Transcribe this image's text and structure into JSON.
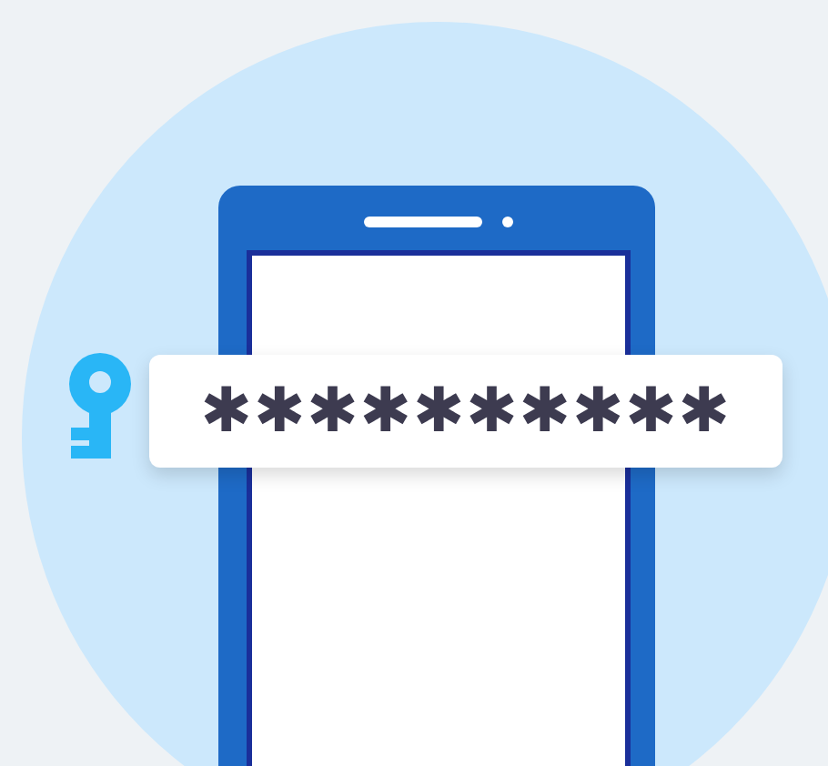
{
  "password_field": {
    "value": "✱✱✱✱✱✱✱✱✱✱"
  }
}
